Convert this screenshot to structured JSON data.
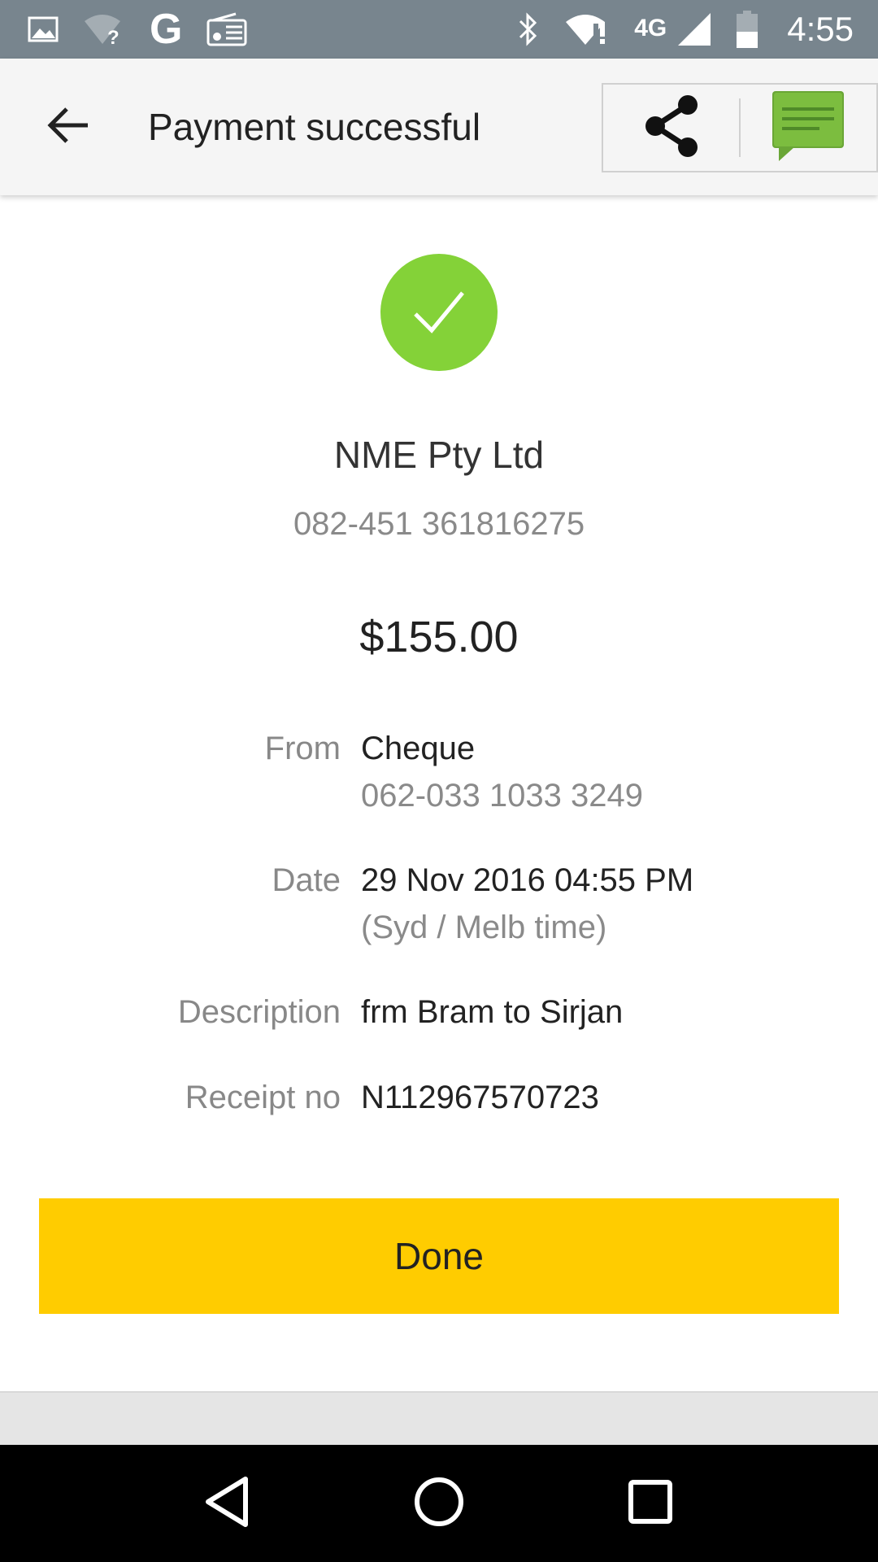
{
  "status_bar": {
    "network_type": "4G",
    "time": "4:55",
    "icons": [
      "image-icon",
      "wifi-unknown-icon",
      "google-g-icon",
      "radio-icon",
      "bluetooth-icon",
      "wifi-alert-icon",
      "cellular-signal-icon",
      "battery-icon"
    ]
  },
  "toolbar": {
    "title": "Payment successful",
    "icons": [
      "back-arrow-icon",
      "share-icon",
      "message-icon"
    ]
  },
  "payment": {
    "payee_name": "NME Pty Ltd",
    "payee_account": "082-451 361816275",
    "amount": "$155.00",
    "from_label": "From",
    "from_account_name": "Cheque",
    "from_account_number": "062-033 1033 3249",
    "date_label": "Date",
    "date_value": "29 Nov 2016 04:55 PM",
    "date_timezone": "(Syd / Melb time)",
    "description_label": "Description",
    "description_value": "frm Bram to Sirjan",
    "receipt_label": "Receipt no",
    "receipt_value": "N112967570723"
  },
  "done_button": {
    "label": "Done"
  },
  "colors": {
    "status_bar": "#78858e",
    "success_green": "#84d238",
    "done_yellow": "#ffcc00",
    "message_green": "#6aa636"
  }
}
